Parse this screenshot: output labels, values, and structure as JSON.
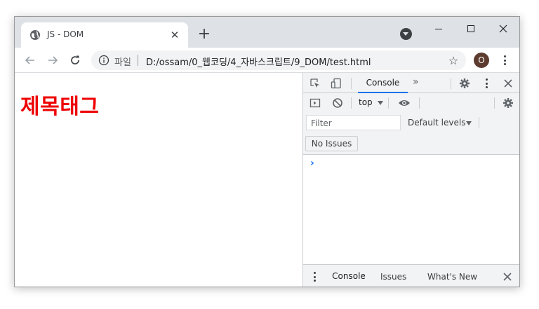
{
  "browser": {
    "tab": {
      "title": "JS - DOM"
    },
    "address": {
      "scheme_label": "파일",
      "url": "D:/ossam/0_웹코딩/4_자바스크립트/9_DOM/test.html"
    },
    "profile_initial": "O"
  },
  "page": {
    "heading": "제목태그",
    "heading_color": "#ee0000"
  },
  "devtools": {
    "active_tab": "Console",
    "more_label": "»",
    "context": "top",
    "filter_placeholder": "Filter",
    "levels_label": "Default levels",
    "issues_button": "No Issues",
    "prompt": "›",
    "drawer_tabs": [
      "Console",
      "Issues",
      "What's New"
    ]
  },
  "icons": {
    "tab_favicon": "globe-icon",
    "info": "info-icon",
    "star": "star-icon",
    "inspect": "inspect-element-icon",
    "device": "device-toggle-icon",
    "settings": "gear-icon",
    "kebab": "more-vertical-icon",
    "close": "close-icon",
    "sidebar": "sidebar-toggle-icon",
    "clear": "clear-console-icon",
    "eye": "live-expression-icon"
  },
  "colors": {
    "accent": "#1a73e8",
    "tabstrip": "#dee1e6",
    "devtools_bg": "#f1f3f4"
  }
}
